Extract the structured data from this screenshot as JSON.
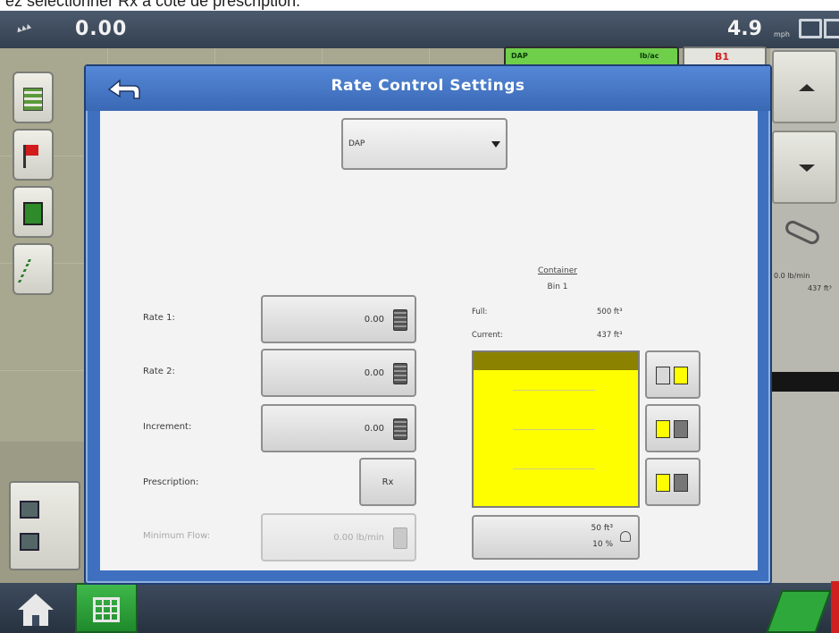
{
  "caption": "ez sélectionner Rx à côté de prescription.",
  "status_bar": {
    "area_value": "0.00",
    "speed_value": "4.9",
    "speed_unit": "mph"
  },
  "product_tab": {
    "left": "DAP",
    "right": "lb/ac"
  },
  "side_readout": {
    "rate": "0.0 lb/min",
    "volume": "437 ft³"
  },
  "dialog": {
    "title": "Rate Control Settings",
    "product_select": {
      "value": "DAP"
    },
    "fields": [
      {
        "label": "Rate 1:",
        "value": "0.00"
      },
      {
        "label": "Rate 2:",
        "value": "0.00"
      },
      {
        "label": "Increment:",
        "value": "0.00"
      }
    ],
    "prescription": {
      "label": "Prescription:",
      "button": "Rx"
    },
    "minimum_flow": {
      "label": "Minimum Flow:",
      "value": "0.00 lb/min"
    },
    "container": {
      "title": "Container",
      "name": "Bin 1",
      "full_label": "Full:",
      "full_value": "500 ft³",
      "current_label": "Current:",
      "current_value": "437 ft³",
      "level_volume": "50 ft³",
      "level_percent": "10 %"
    }
  },
  "colors": {
    "dialog_blue": "#3e70bf",
    "tank_yellow": "#fefe00",
    "tank_top": "#8b8200",
    "green_accent": "#3fb84a"
  }
}
